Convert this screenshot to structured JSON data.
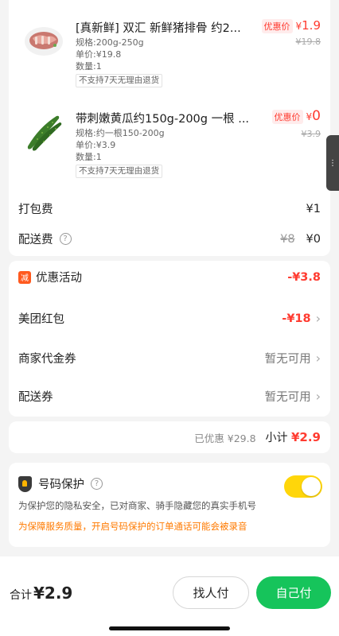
{
  "products": [
    {
      "title": "[真新鲜] 双汇 新鲜猪排骨 约2...",
      "spec": "规格:200g-250g",
      "unit_price": "单价:¥19.8",
      "quantity": "数量:1",
      "tag": "不支持7天无理由退货",
      "promo_label": "优惠价",
      "promo_currency": "¥",
      "promo_price": "1.9",
      "original_price": "¥19.8",
      "image_icon": "pork-ribs-image"
    },
    {
      "title": "带刺嫩黄瓜约150g-200g 一根 ...",
      "spec": "规格:约一根150-200g",
      "unit_price": "单价:¥3.9",
      "quantity": "数量:1",
      "tag": "不支持7天无理由退货",
      "promo_label": "优惠价",
      "promo_currency": "¥",
      "promo_price": "0",
      "original_price": "¥3.9",
      "image_icon": "cucumber-image"
    }
  ],
  "fees": {
    "packing_label": "打包费",
    "packing_value": "¥1",
    "delivery_label": "配送费",
    "delivery_original": "¥8",
    "delivery_value": "¥0"
  },
  "coupons": {
    "activity_badge": "减",
    "activity_label": "优惠活动",
    "activity_value": "-¥3.8",
    "redpacket_label": "美团红包",
    "redpacket_value": "-¥18",
    "merchant_label": "商家代金券",
    "merchant_value": "暂无可用",
    "delivery_coupon_label": "配送券",
    "delivery_coupon_value": "暂无可用"
  },
  "subtotal": {
    "discount_text": "已优惠 ¥29.8",
    "label": "小计",
    "value": "¥2.9"
  },
  "privacy": {
    "title": "号码保护",
    "description": "为保护您的隐私安全，已对商家、骑手隐藏您的真实手机号",
    "warning": "为保障服务质量，开启号码保护的订单通话可能会被录音",
    "enabled": true
  },
  "footer": {
    "total_label": "合计",
    "total_value": "¥2.9",
    "find_pay_label": "找人付",
    "self_pay_label": "自己付"
  },
  "colors": {
    "accent_red": "#ff3b30",
    "pay_green": "#16c45b",
    "toggle_yellow": "#ffd60a",
    "warn_orange": "#ff7a00"
  }
}
